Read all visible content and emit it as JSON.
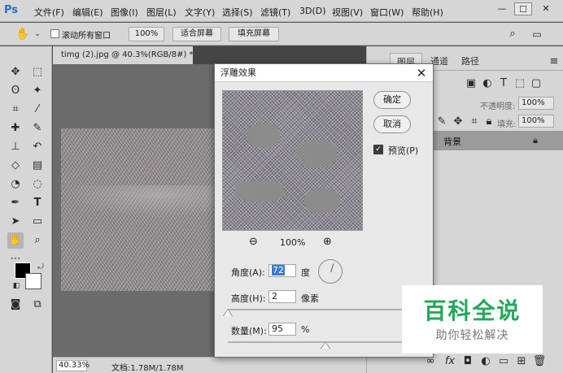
{
  "app": {
    "logo": "Ps"
  },
  "menu": [
    "文件(F)",
    "编辑(E)",
    "图像(I)",
    "图层(L)",
    "文字(Y)",
    "选择(S)",
    "滤镜(T)",
    "3D(D)",
    "视图(V)",
    "窗口(W)",
    "帮助(H)"
  ],
  "window_controls": {
    "minimize": "—",
    "maximize": "☐",
    "close": "✕"
  },
  "options_bar": {
    "scroll_all_label": "滚动所有窗口",
    "zoom_100": "100%",
    "fit_screen": "适合屏幕",
    "fill_screen": "填充屏幕"
  },
  "document": {
    "tab_title": "timg (2).jpg @ 40.3%(RGB/8#) *",
    "zoom": "40.33%",
    "doc_info": "文档:1.78M/1.78M"
  },
  "layers_panel": {
    "tabs": [
      "图层",
      "通道",
      "路径"
    ],
    "opacity_label": "不透明度:",
    "opacity_value": "100%",
    "fill_label": "填充:",
    "fill_value": "100%",
    "layer_name": "背景"
  },
  "dialog": {
    "title": "浮雕效果",
    "ok": "确定",
    "cancel": "取消",
    "preview_label": "预览(P)",
    "preview_checked": true,
    "preview_zoom": "100%",
    "angle_label": "角度(A):",
    "angle_value": "72",
    "angle_unit": "度",
    "height_label": "高度(H):",
    "height_value": "2",
    "height_unit": "像素",
    "amount_label": "数量(M):",
    "amount_value": "95",
    "amount_unit": "%"
  },
  "watermark": {
    "main": "百科全说",
    "sub": "助你轻松解决"
  },
  "colors": {
    "ui_gray": "#d6d6d6",
    "workspace": "#535353",
    "brand_green": "#23a85a",
    "accent_blue": "#2b6fc5"
  }
}
